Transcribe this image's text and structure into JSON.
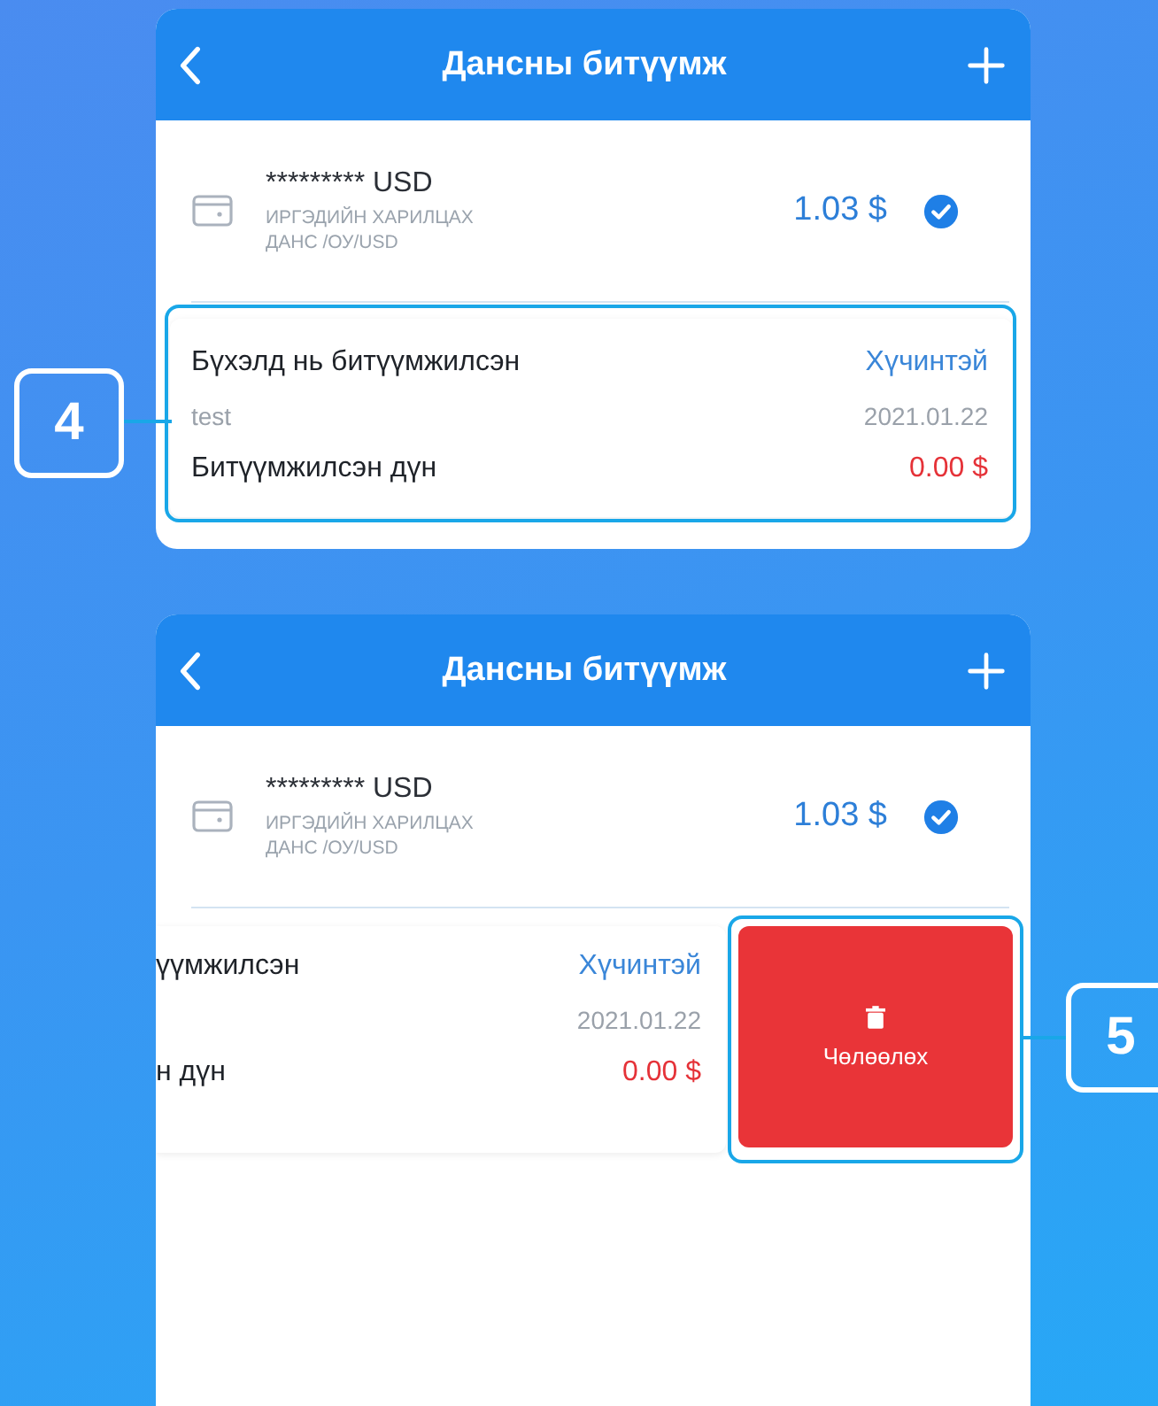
{
  "screens": [
    {
      "header": {
        "title": "Дансны битүүмж"
      },
      "account": {
        "number": "********* USD",
        "type": "ИРГЭДИЙН ХАРИЛЦАХ ДАНС /ОУ/USD",
        "balance": "1.03 $",
        "selected": true
      },
      "freeze": {
        "swiped": false,
        "title": "Бүхэлд нь битүүмжилсэн",
        "status": "Хүчинтэй",
        "note": "test",
        "date": "2021.01.22",
        "amount_label": "Битүүмжилсэн дүн",
        "amount": "0.00 $"
      },
      "callout": {
        "number": "4",
        "kind": "card"
      }
    },
    {
      "header": {
        "title": "Дансны битүүмж"
      },
      "account": {
        "number": "********* USD",
        "type": "ИРГЭДИЙН ХАРИЛЦАХ ДАНС /ОУ/USD",
        "balance": "1.03 $",
        "selected": true
      },
      "freeze": {
        "swiped": true,
        "title": "үүмжилсэн",
        "status": "Хүчинтэй",
        "date": "2021.01.22",
        "amount_label": "н дүн",
        "amount": "0.00 $",
        "delete_label": "Чөлөөлөх"
      },
      "callout": {
        "number": "5",
        "kind": "delete"
      }
    }
  ]
}
